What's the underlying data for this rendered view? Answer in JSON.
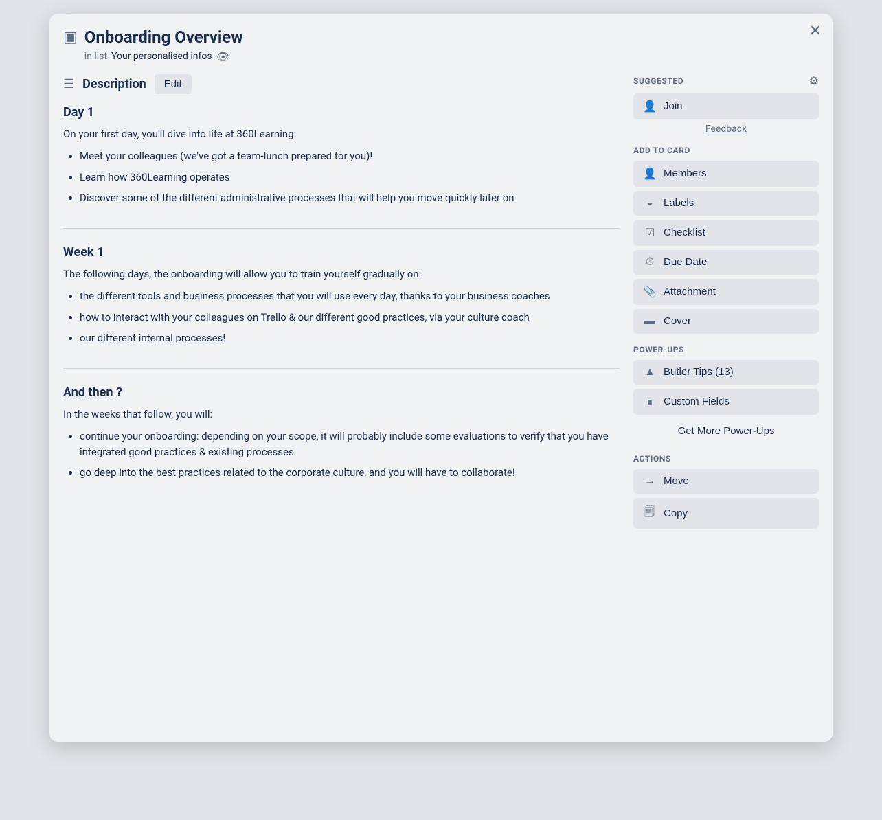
{
  "modal": {
    "title": "Onboarding Overview",
    "subtitle_prefix": "in list",
    "list_name": "Your personalised infos",
    "close_label": "✕"
  },
  "description": {
    "label": "Description",
    "edit_button": "Edit"
  },
  "sections": [
    {
      "id": "day1",
      "title": "Day 1",
      "intro": "On your first day, you'll dive into life at 360Learning:",
      "items": [
        "Meet your colleagues (we've got a team-lunch prepared for you)!",
        "Learn how 360Learning operates",
        "Discover some of the different administrative processes that will help you move quickly later on"
      ]
    },
    {
      "id": "week1",
      "title": "Week 1",
      "intro": "The following days, the onboarding will allow you to train yourself gradually on:",
      "items": [
        "the different tools and business processes that you will use every day, thanks to your business coaches",
        "how to interact with your colleagues on Trello & our different good practices, via your culture coach",
        "our different internal processes!"
      ]
    },
    {
      "id": "andthen",
      "title": "And then ?",
      "intro": "In the weeks that follow, you will:",
      "items": [
        "continue your onboarding: depending on your scope, it will probably include some evaluations to verify that you have integrated good practices & existing processes",
        "go deep into the best practices related to the corporate culture, and you will have to collaborate!"
      ]
    }
  ],
  "sidebar": {
    "suggested_label": "SUGGESTED",
    "add_to_card_label": "ADD TO CARD",
    "power_ups_label": "POWER-UPS",
    "actions_label": "ACTIONS",
    "join_label": "Join",
    "feedback_label": "Feedback",
    "members_label": "Members",
    "labels_label": "Labels",
    "checklist_label": "Checklist",
    "due_date_label": "Due Date",
    "attachment_label": "Attachment",
    "cover_label": "Cover",
    "butler_tips_label": "Butler Tips (13)",
    "custom_fields_label": "Custom Fields",
    "get_more_label": "Get More Power-Ups",
    "move_label": "Move",
    "copy_label": "Copy"
  }
}
